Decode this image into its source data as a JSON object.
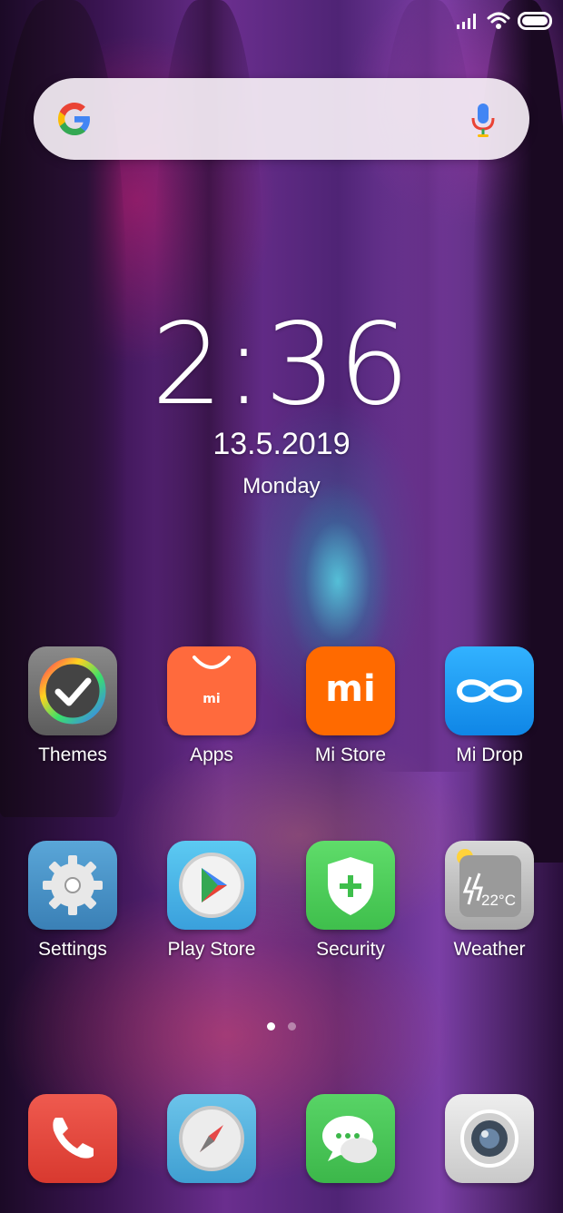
{
  "status_bar": {
    "signal_icon": "signal-icon",
    "wifi_icon": "wifi-icon",
    "battery_icon": "battery-icon"
  },
  "search": {
    "logo_icon": "google-g-icon",
    "mic_icon": "microphone-icon"
  },
  "clock": {
    "time": "2:36",
    "date": "13.5.2019",
    "day": "Monday"
  },
  "apps_row1": [
    {
      "label": "Themes"
    },
    {
      "label": "Apps"
    },
    {
      "label": "Mi Store"
    },
    {
      "label": "Mi Drop"
    }
  ],
  "apps_row2": [
    {
      "label": "Settings"
    },
    {
      "label": "Play Store"
    },
    {
      "label": "Security"
    },
    {
      "label": "Weather"
    }
  ],
  "icon_text": {
    "apps_mi": "mi",
    "mistore_mi": "mi",
    "weather_temp": "22°C"
  },
  "page_indicator": {
    "pages": 2,
    "active": 1
  },
  "dock": [
    {
      "icon": "phone-icon"
    },
    {
      "icon": "browser-compass-icon"
    },
    {
      "icon": "messages-icon"
    },
    {
      "icon": "camera-icon"
    }
  ],
  "colors": {
    "themes": "#6e6e6e",
    "apps": "#ff6a3d",
    "mistore": "#ff6a00",
    "midrop": "#1a9df0",
    "settings": "#4a94c8",
    "playstore": "#4ab8e6",
    "security": "#4fcf5a",
    "weather": "#b8b8b8",
    "phone": "#e5453b",
    "browser": "#5bb5e0",
    "messages": "#48c458",
    "camera": "#dcdcdc"
  }
}
